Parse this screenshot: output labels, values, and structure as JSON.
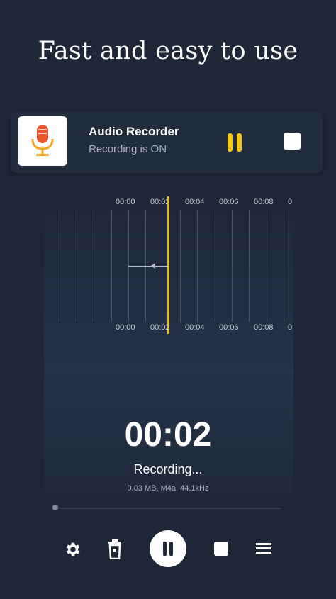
{
  "headline": "Fast and easy to use",
  "notification": {
    "app_name": "Audio Recorder",
    "status": "Recording is ON",
    "icons": {
      "app": "microphone-icon",
      "pause": "pause-icon",
      "stop": "stop-icon"
    },
    "accent": "#f5c518"
  },
  "waveform": {
    "top_ticks": [
      "00:00",
      "00:02",
      "00:04",
      "00:06",
      "00:08",
      "0"
    ],
    "bottom_ticks": [
      "00:00",
      "00:02",
      "00:04",
      "00:06",
      "00:08",
      "0"
    ],
    "cursor_color": "#e3b72a"
  },
  "recording": {
    "timer": "00:02",
    "status": "Recording...",
    "meta": "0.03 MB, M4a, 44.1kHz",
    "progress": 0.0
  },
  "toolbar": {
    "settings_icon": "gear-icon",
    "delete_icon": "trash-icon",
    "pause_icon": "pause-icon",
    "stop_icon": "stop-icon",
    "list_icon": "list-icon"
  },
  "colors": {
    "background": "#1e2737",
    "card": "#212c3d",
    "accent": "#f5c518"
  }
}
